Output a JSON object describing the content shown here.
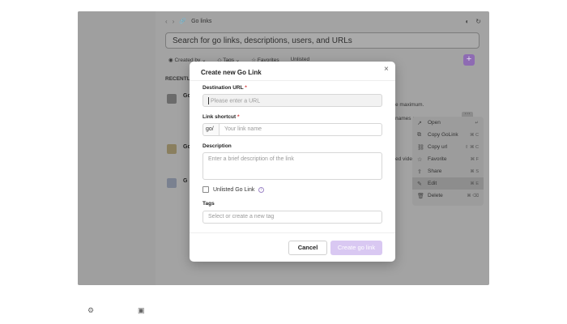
{
  "nav": {
    "back_arrow": "‹",
    "forward_arrow": "›",
    "breadcrumb": "Go links"
  },
  "search": {
    "placeholder": "Search for go links, descriptions, users, and URLs"
  },
  "filters": {
    "created_by": "Created by",
    "tags": "Tags",
    "favorites": "Favorites",
    "unlisted": "Unlisted"
  },
  "list": {
    "section_label": "RECENTLY",
    "items": [
      {
        "title": "Go"
      },
      {
        "title": "Go"
      },
      {
        "title": "G"
      }
    ],
    "bg_fragments": {
      "maximum": "e maximum.",
      "names_are": "names are",
      "edit_video": "ed vide..."
    }
  },
  "context_menu": {
    "items": [
      {
        "label": "Open",
        "shortcut": "↵"
      },
      {
        "label": "Copy GoLink",
        "shortcut": "⌘ C"
      },
      {
        "label": "Copy url",
        "shortcut": "⇧ ⌘ C"
      },
      {
        "label": "Favorite",
        "shortcut": "⌘ F"
      },
      {
        "label": "Share",
        "shortcut": "⌘ S"
      },
      {
        "label": "Edit",
        "shortcut": "⌘ E"
      },
      {
        "label": "Delete",
        "shortcut": "⌘ ⌫"
      }
    ],
    "active_index": 5
  },
  "modal": {
    "title": "Create new Go Link",
    "close_symbol": "×",
    "destination": {
      "label": "Destination URL",
      "required_mark": "*",
      "placeholder": "Please enter a URL"
    },
    "shortcut": {
      "label": "Link shortcut",
      "required_mark": "*",
      "prefix": "go/",
      "placeholder": "Your link name"
    },
    "description": {
      "label": "Description",
      "placeholder": "Enter a brief description of the link"
    },
    "unlisted": {
      "label": "Unlisted Go Link"
    },
    "tags": {
      "label": "Tags",
      "placeholder": "Select or create a new tag"
    },
    "cancel_label": "Cancel",
    "create_label": "Create go link"
  },
  "colors": {
    "accent": "#8e6bb3",
    "create_button": "#d9c8f2",
    "required": "#d43a3a"
  }
}
